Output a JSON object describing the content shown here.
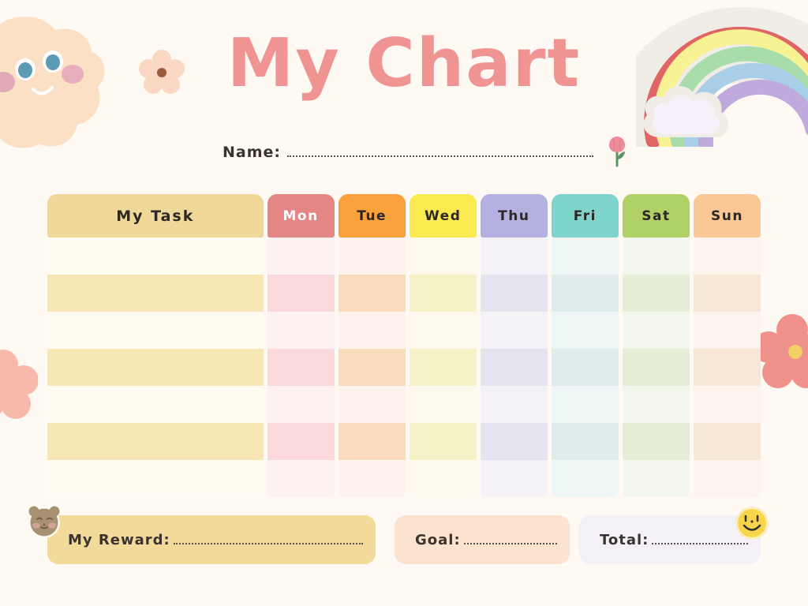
{
  "page": {
    "title": "My Chart",
    "background_color": "#FEFAF3",
    "title_color": "#F09393"
  },
  "name_field": {
    "label": "Name:",
    "value": "",
    "placeholder": ""
  },
  "table": {
    "task_column_header": "My Task",
    "day_headers": [
      {
        "label": "Mon",
        "header_color": "#E58585",
        "row_light": "#FDF1F2",
        "row_dark": "#F9D9DC",
        "text_color": "#FFFFFF"
      },
      {
        "label": "Tue",
        "header_color": "#F9A13C",
        "row_light": "#FDF3EC",
        "row_dark": "#F8DCBB",
        "text_color": "#2E2823"
      },
      {
        "label": "Wed",
        "header_color": "#FAE94F",
        "row_light": "#FDF9EC",
        "row_dark": "#F5F2C6",
        "text_color": "#2E2823"
      },
      {
        "label": "Thu",
        "header_color": "#B4B0DF",
        "row_light": "#F4F2F6",
        "row_dark": "#E5E3EE",
        "text_color": "#2E2823"
      },
      {
        "label": "Fri",
        "header_color": "#7FD4CE",
        "row_light": "#EFF6F6",
        "row_dark": "#DEEDEC",
        "text_color": "#2E2823"
      },
      {
        "label": "Sat",
        "header_color": "#AFD166",
        "row_light": "#F4F7EC",
        "row_dark": "#E5EED7",
        "text_color": "#2E2823"
      },
      {
        "label": "Sun",
        "header_color": "#FAC795",
        "row_light": "#FDF4EE",
        "row_dark": "#F8E6D6",
        "text_color": "#2E2823"
      }
    ],
    "task_header_color": "#EFD89A",
    "task_row_light": "#FFFBF0",
    "task_row_dark": "#F7E7B6",
    "row_count": 7,
    "rows": [
      {
        "task": "",
        "days": [
          "",
          "",
          "",
          "",
          "",
          "",
          ""
        ]
      },
      {
        "task": "",
        "days": [
          "",
          "",
          "",
          "",
          "",
          "",
          ""
        ]
      },
      {
        "task": "",
        "days": [
          "",
          "",
          "",
          "",
          "",
          "",
          ""
        ]
      },
      {
        "task": "",
        "days": [
          "",
          "",
          "",
          "",
          "",
          "",
          ""
        ]
      },
      {
        "task": "",
        "days": [
          "",
          "",
          "",
          "",
          "",
          "",
          ""
        ]
      },
      {
        "task": "",
        "days": [
          "",
          "",
          "",
          "",
          "",
          "",
          ""
        ]
      },
      {
        "task": "",
        "days": [
          "",
          "",
          "",
          "",
          "",
          "",
          ""
        ]
      }
    ]
  },
  "footer": {
    "reward": {
      "label": "My Reward:",
      "value": "",
      "color": "#F2DA9B"
    },
    "goal": {
      "label": "Goal:",
      "value": "",
      "color": "#FBE3D0"
    },
    "total": {
      "label": "Total:",
      "value": "",
      "color": "#F3F0F7"
    }
  },
  "decorations": {
    "cloud_character": "smiling-cloud-sticker",
    "rainbow": "rainbow-cloud-sticker",
    "flower_top": "flower-sticker",
    "flower_left": "flower-sticker",
    "flower_right": "flower-sticker",
    "tulip": "tulip-sticker",
    "bear": "bear-face-sticker",
    "smiley": "smiley-face-sticker"
  }
}
